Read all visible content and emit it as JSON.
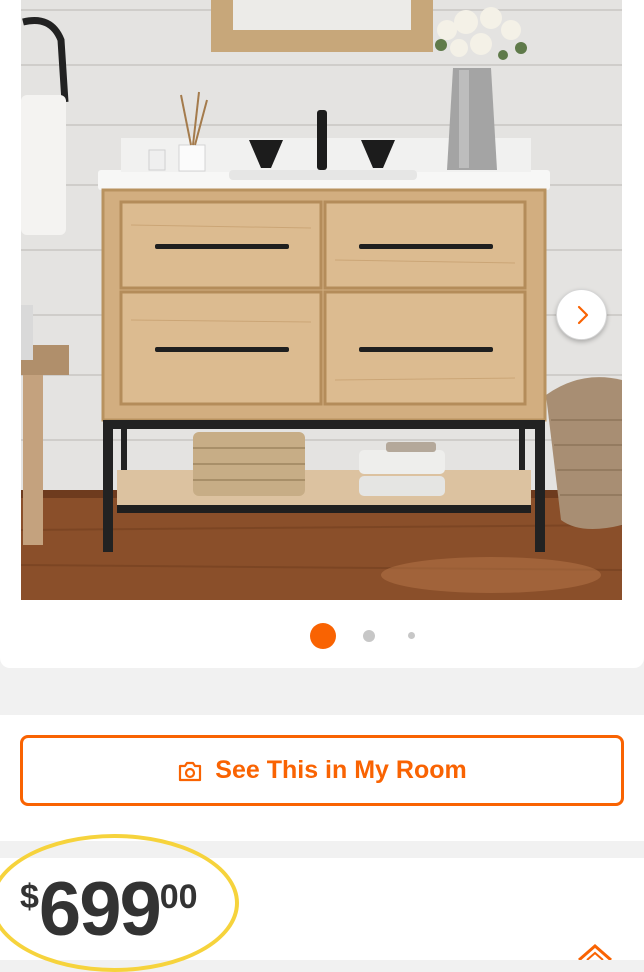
{
  "gallery": {
    "image_alt": "Light oak bathroom vanity with white top, four drawers with black pulls and black metal open shelf base",
    "dots": [
      true,
      false,
      false
    ],
    "next_icon": "chevron-right-icon"
  },
  "actions": {
    "see_in_room_label": "See This in My Room",
    "camera_icon": "camera-icon"
  },
  "pricing": {
    "currency": "$",
    "dollars": "699",
    "cents": "00"
  },
  "colors": {
    "accent": "#f96302",
    "highlight": "#f6d33c",
    "price_text": "#333333"
  }
}
